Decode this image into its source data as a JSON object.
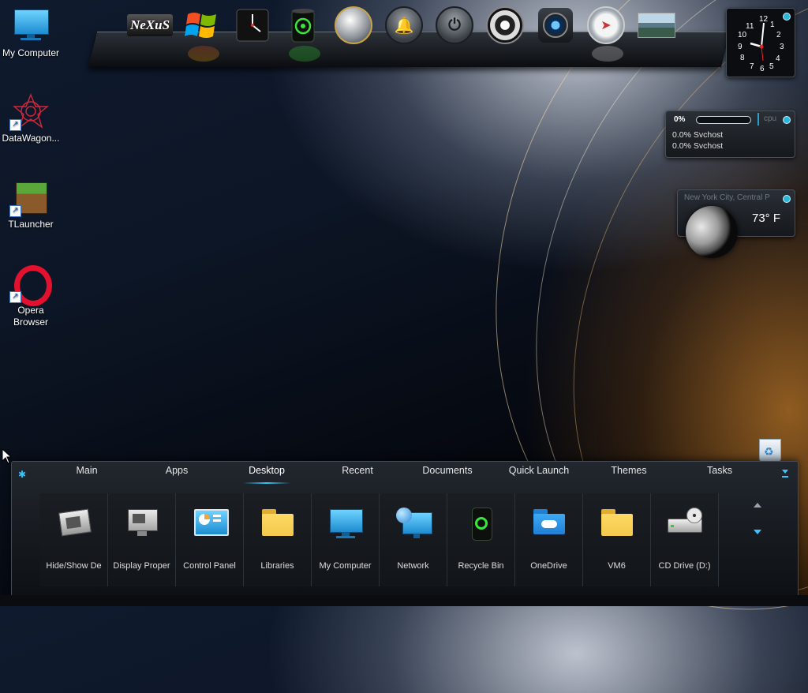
{
  "desktop_icons": [
    {
      "name": "my-computer",
      "label": "My Computer"
    },
    {
      "name": "datawagon",
      "label": "DataWagon..."
    },
    {
      "name": "tlauncher",
      "label": "TLauncher"
    },
    {
      "name": "opera",
      "label": "Opera Browser"
    }
  ],
  "dock": {
    "logo_text": "NeXuS",
    "items": [
      "nexus-logo",
      "windows-logo",
      "clock",
      "recycle-bin",
      "internet",
      "notification-bell",
      "power",
      "speaker",
      "camera",
      "compass",
      "photo"
    ]
  },
  "clock_gadget": {
    "numbers": [
      "12",
      "1",
      "2",
      "3",
      "4",
      "5",
      "6",
      "7",
      "8",
      "9",
      "10",
      "11"
    ]
  },
  "cpu_gadget": {
    "title": "cpu",
    "percent": "0%",
    "usage": 0,
    "processes": [
      "0.0% Svchost",
      "0.0% Svchost"
    ]
  },
  "weather_gadget": {
    "location": "New York City, Central P",
    "temperature": "73° F"
  },
  "panel": {
    "tabs": [
      "Main",
      "Apps",
      "Desktop",
      "Recent",
      "Documents",
      "Quick Launch",
      "Themes",
      "Tasks"
    ],
    "active_tab": "Desktop",
    "items": [
      {
        "label": "Hide/Show De",
        "icon": "desktop-toggle-icon"
      },
      {
        "label": "Display Proper",
        "icon": "display-icon"
      },
      {
        "label": "Control Panel",
        "icon": "control-panel-icon"
      },
      {
        "label": "Libraries",
        "icon": "folder-icon"
      },
      {
        "label": "My Computer",
        "icon": "monitor-icon"
      },
      {
        "label": "Network",
        "icon": "network-icon"
      },
      {
        "label": "Recycle Bin",
        "icon": "recycle-bin-icon"
      },
      {
        "label": "OneDrive",
        "icon": "onedrive-icon"
      },
      {
        "label": "VM6",
        "icon": "folder-icon"
      },
      {
        "label": "CD Drive (D:)",
        "icon": "cd-drive-icon"
      }
    ]
  },
  "colors": {
    "accent": "#35c6ff",
    "folder": "#f2c94c",
    "monitor": "#36b6e8"
  }
}
